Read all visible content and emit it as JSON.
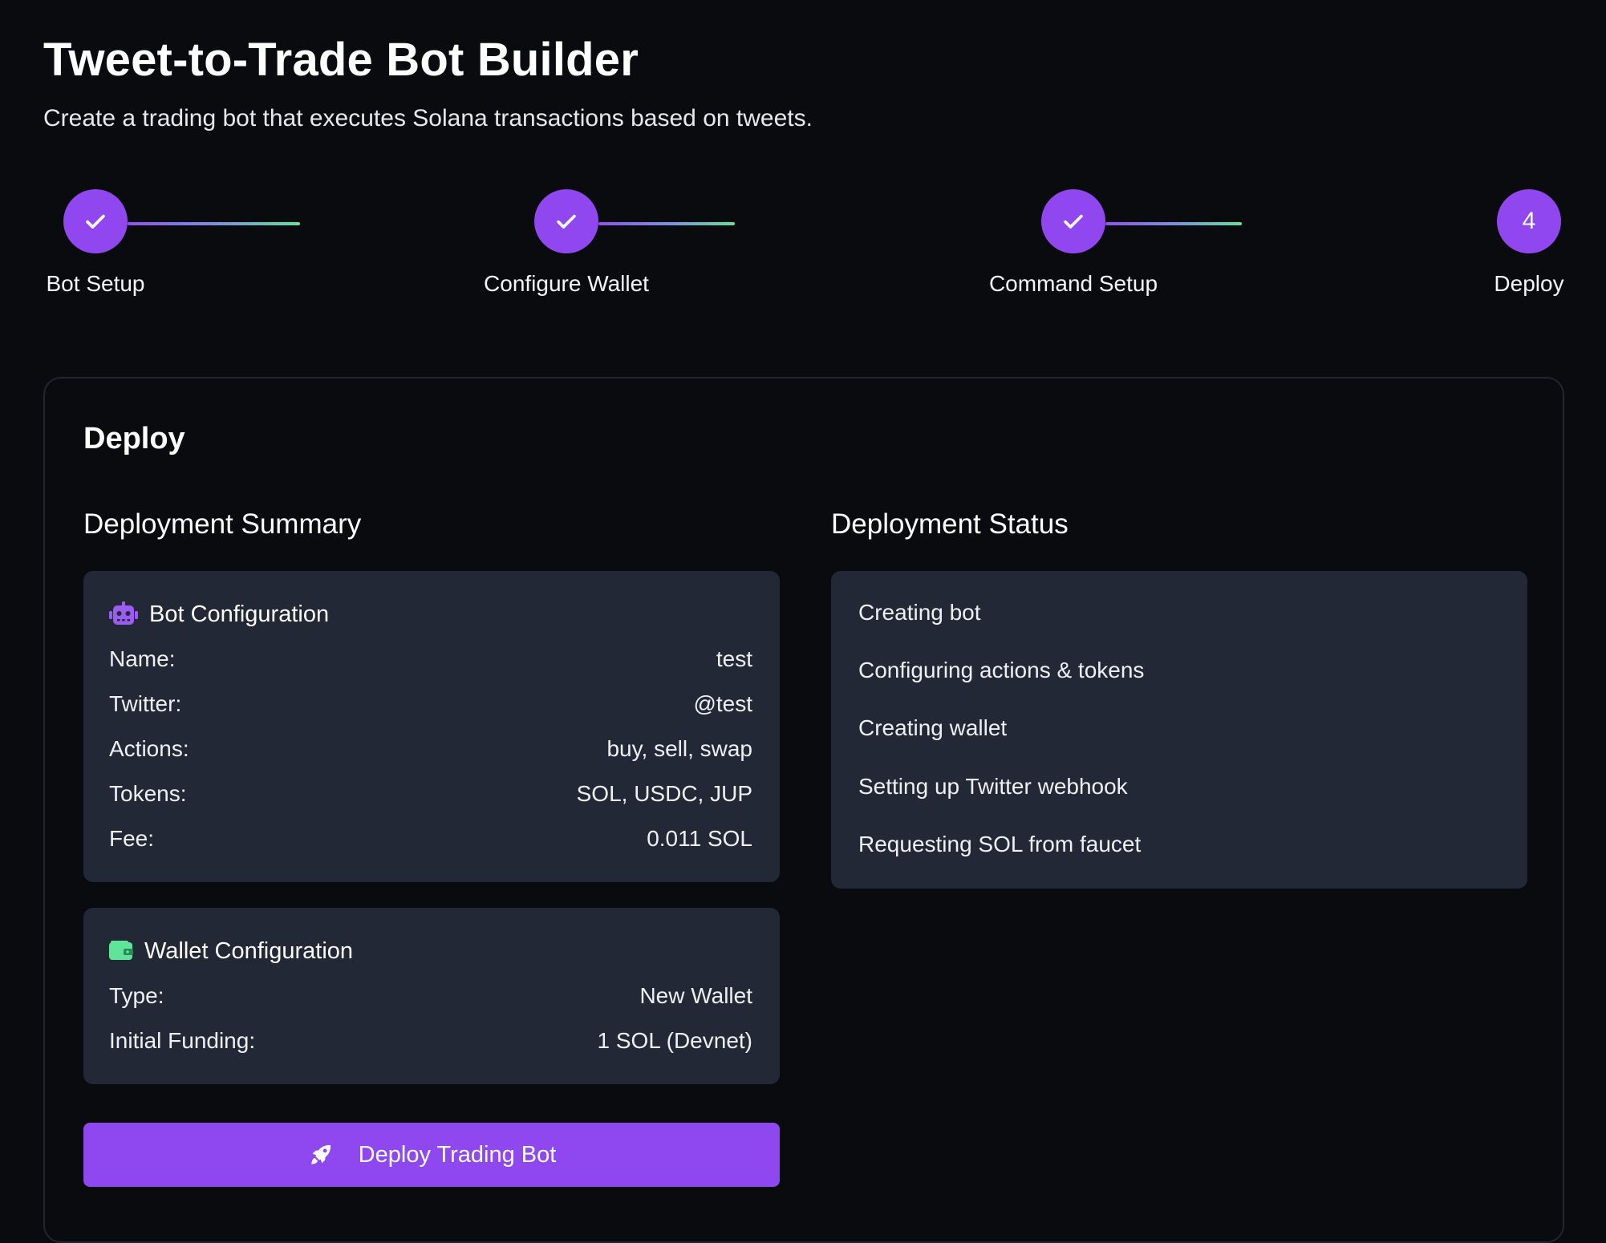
{
  "header": {
    "title": "Tweet-to-Trade Bot Builder",
    "subtitle": "Create a trading bot that executes Solana transactions based on tweets."
  },
  "stepper": {
    "steps": [
      {
        "label": "Bot Setup",
        "state": "complete",
        "icon": "check-icon"
      },
      {
        "label": "Configure Wallet",
        "state": "complete",
        "icon": "check-icon"
      },
      {
        "label": "Command Setup",
        "state": "complete",
        "icon": "check-icon"
      },
      {
        "label": "Deploy",
        "state": "current",
        "number": "4"
      }
    ]
  },
  "panel": {
    "title": "Deploy",
    "summary": {
      "title": "Deployment Summary",
      "bot_config": {
        "title": "Bot Configuration",
        "icon": "robot-icon",
        "rows": [
          {
            "label": "Name:",
            "value": "test"
          },
          {
            "label": "Twitter:",
            "value": "@test"
          },
          {
            "label": "Actions:",
            "value": "buy, sell, swap"
          },
          {
            "label": "Tokens:",
            "value": "SOL, USDC, JUP"
          },
          {
            "label": "Fee:",
            "value": "0.011 SOL"
          }
        ]
      },
      "wallet_config": {
        "title": "Wallet Configuration",
        "icon": "wallet-icon",
        "rows": [
          {
            "label": "Type:",
            "value": "New Wallet"
          },
          {
            "label": "Initial Funding:",
            "value": "1 SOL (Devnet)"
          }
        ]
      },
      "deploy_button": {
        "label": "Deploy Trading Bot",
        "icon": "rocket-icon"
      }
    },
    "status": {
      "title": "Deployment Status",
      "items": [
        "Creating bot",
        "Configuring actions & tokens",
        "Creating wallet",
        "Setting up Twitter webhook",
        "Requesting SOL from faucet"
      ]
    }
  },
  "colors": {
    "background": "#0a0b0e",
    "accent": "#9147f0",
    "card": "#222836",
    "wallet_green": "#5fe49a",
    "robot_purple": "#9b5cf0"
  }
}
